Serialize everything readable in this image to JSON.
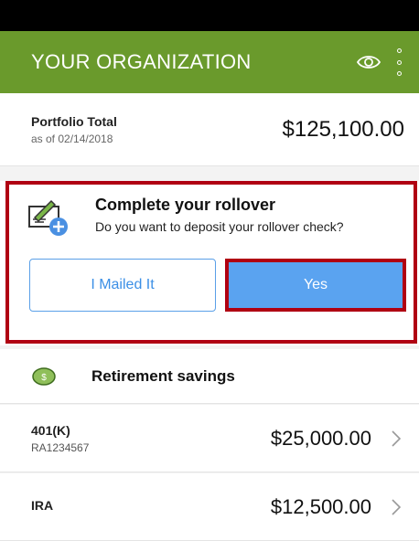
{
  "header": {
    "title": "YOUR ORGANIZATION",
    "icons": [
      "eye-icon",
      "kebab-menu-icon"
    ],
    "color": "#6a9a2c"
  },
  "portfolio": {
    "label": "Portfolio Total",
    "date": "as of 02/14/2018",
    "amount": "$125,100.00"
  },
  "rollover": {
    "title": "Complete your rollover",
    "subtitle": "Do you want to deposit your rollover check?",
    "mailed_label": "I Mailed It",
    "yes_label": "Yes",
    "accent": "#5aa3f0",
    "highlight": "#b00012"
  },
  "retirement": {
    "label": "Retirement savings",
    "accounts": [
      {
        "name": "401(K)",
        "id": "RA1234567",
        "amount": "$25,000.00"
      },
      {
        "name": "IRA",
        "id": "",
        "amount": "$12,500.00"
      }
    ]
  }
}
